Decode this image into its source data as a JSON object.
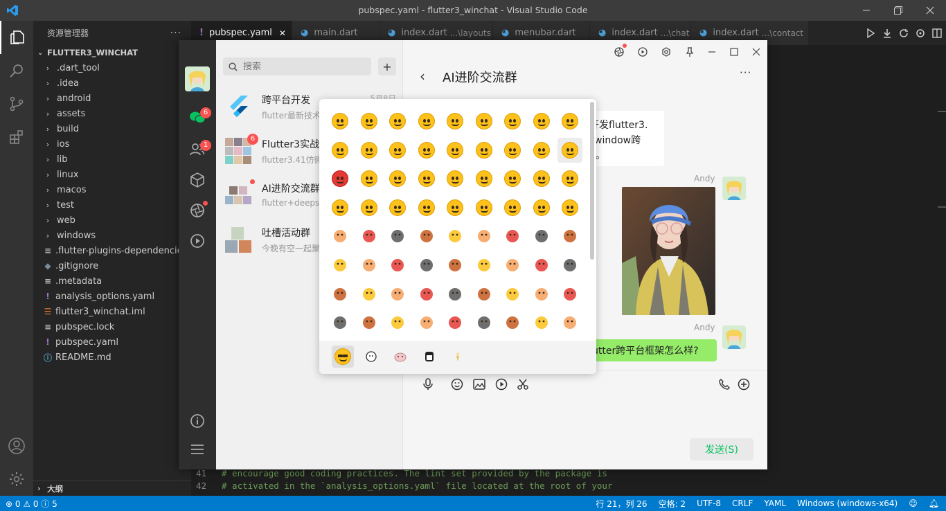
{
  "window": {
    "title": "pubspec.yaml - flutter3_winchat - Visual Studio Code"
  },
  "sidebar": {
    "header": "资源管理器",
    "more": "···",
    "project": "FLUTTER3_WINCHAT",
    "items": [
      {
        "label": ".dart_tool",
        "kind": "folder"
      },
      {
        "label": ".idea",
        "kind": "folder"
      },
      {
        "label": "android",
        "kind": "folder"
      },
      {
        "label": "assets",
        "kind": "folder"
      },
      {
        "label": "build",
        "kind": "folder"
      },
      {
        "label": "ios",
        "kind": "folder"
      },
      {
        "label": "lib",
        "kind": "folder"
      },
      {
        "label": "linux",
        "kind": "folder"
      },
      {
        "label": "macos",
        "kind": "folder"
      },
      {
        "label": "test",
        "kind": "folder"
      },
      {
        "label": "web",
        "kind": "folder"
      },
      {
        "label": "windows",
        "kind": "folder"
      },
      {
        "label": ".flutter-plugins-dependencies",
        "kind": "lines"
      },
      {
        "label": ".gitignore",
        "kind": "git"
      },
      {
        "label": ".metadata",
        "kind": "lines"
      },
      {
        "label": "analysis_options.yaml",
        "kind": "yaml"
      },
      {
        "label": "flutter3_winchat.iml",
        "kind": "rss"
      },
      {
        "label": "pubspec.lock",
        "kind": "lines"
      },
      {
        "label": "pubspec.yaml",
        "kind": "yaml"
      },
      {
        "label": "README.md",
        "kind": "info"
      }
    ],
    "outline": "大纲"
  },
  "tabs": [
    {
      "label": "pubspec.yaml",
      "hint": "",
      "active": true
    },
    {
      "label": "main.dart",
      "hint": "",
      "active": false
    },
    {
      "label": "index.dart",
      "hint": "...\\layouts",
      "active": false
    },
    {
      "label": "menubar.dart",
      "hint": "",
      "active": false
    },
    {
      "label": "index.dart",
      "hint": "...\\chat",
      "active": false
    },
    {
      "label": "index.dart",
      "hint": "...\\contact",
      "active": false
    }
  ],
  "code": [
    {
      "ln": "41",
      "text": "# encourage good coding practices. The lint set provided by the package is"
    },
    {
      "ln": "42",
      "text": "# activated in the `analysis_options.yaml` file located at the root of your"
    }
  ],
  "statusbar": {
    "problems": "⊗ 0 ⚠ 0 ⓘ 5",
    "position": "行 21，列 26",
    "spaces": "空格: 2",
    "encoding": "UTF-8",
    "eol": "CRLF",
    "language": "YAML",
    "platform": "Windows (windows-x64)"
  },
  "app": {
    "badges": {
      "chat": "6",
      "contacts": "1"
    },
    "search": {
      "placeholder": "搜索"
    },
    "plus": "+",
    "chats": [
      {
        "name": "跨平台开发",
        "preview": "flutter最新技术",
        "time": "5月8日"
      },
      {
        "name": "Flutter3实战",
        "preview": "flutter3.41仿微",
        "time": "",
        "badge": "6"
      },
      {
        "name": "AI进阶交流群",
        "preview": "flutter+deepse",
        "time": ""
      },
      {
        "name": "吐槽活动群",
        "preview": "今晚有空一起聚",
        "time": ""
      }
    ],
    "chat": {
      "title": "AI进阶交流群",
      "back": "‹",
      "more": "···",
      "left_message": "开发flutter3.\n_window跨\nE。",
      "sender1": "Andy",
      "sender2": "Andy",
      "right_message": "utter跨平台框架怎么样?",
      "send_label": "发送(S)"
    },
    "emoji_tabs": [
      "emoji",
      "sticker-1",
      "sticker-2",
      "sticker-3",
      "sticker-4"
    ]
  }
}
